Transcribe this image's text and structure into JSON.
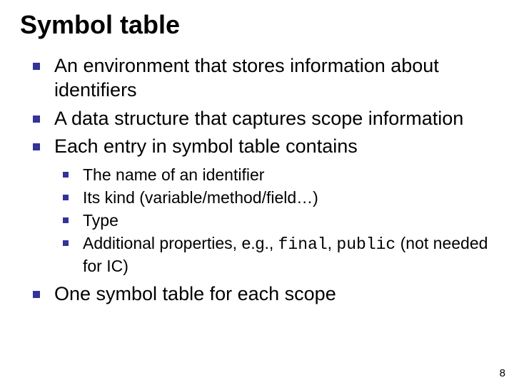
{
  "title": "Symbol table",
  "bullets": {
    "b1": "An environment that stores information about identifiers",
    "b2": "A data structure that captures scope information",
    "b3": "Each entry in symbol table contains",
    "b3_sub": {
      "s1": "The name of an identifier",
      "s2": "Its kind (variable/method/field…)",
      "s3": "Type",
      "s4_prefix": "Additional properties, e.g., ",
      "s4_code1": "final",
      "s4_mid": ", ",
      "s4_code2": "public",
      "s4_suffix": " (not needed for IC)"
    },
    "b4": "One symbol table for each scope"
  },
  "page_number": "8"
}
